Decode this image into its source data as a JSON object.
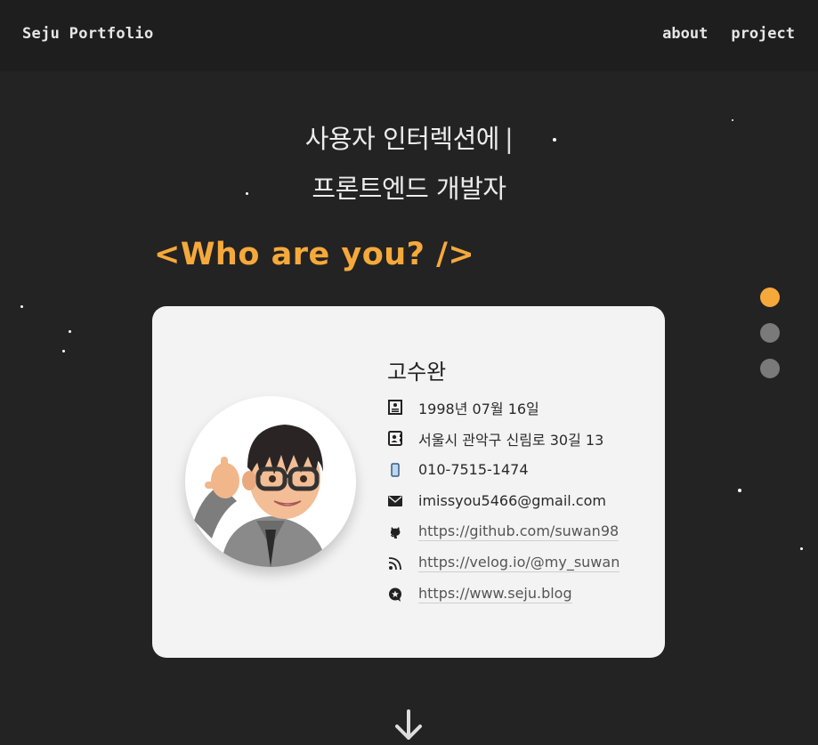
{
  "header": {
    "brand": "Seju Portfolio",
    "nav": [
      {
        "label": "about"
      },
      {
        "label": "project"
      }
    ]
  },
  "hero": {
    "line1": "사용자 인터렉션에",
    "cursor": "|",
    "line2": "프론트엔드 개발자"
  },
  "section": {
    "title": "<Who are you? />"
  },
  "colors": {
    "background": "#232323",
    "accent": "#f6a93b",
    "card": "#f3f3f3",
    "dot_inactive": "#7a7a7a"
  },
  "page_dots": {
    "count": 3,
    "active_index": 0
  },
  "profile": {
    "name": "고수완",
    "rows": [
      {
        "icon": "id-card-icon",
        "text": "1998년 07월 16일",
        "link": false
      },
      {
        "icon": "address-card-icon",
        "text": "서울시 관악구 신림로 30길 13",
        "link": false
      },
      {
        "icon": "mobile-phone-icon",
        "text": "010-7515-1474",
        "link": false
      },
      {
        "icon": "envelope-icon",
        "text": "imissyou5466@gmail.com",
        "link": false
      },
      {
        "icon": "github-icon",
        "text": "https://github.com/suwan98",
        "link": true
      },
      {
        "icon": "rss-icon",
        "text": "https://velog.io/@my_suwan",
        "link": true
      },
      {
        "icon": "star-badge-icon",
        "text": "https://www.seju.blog",
        "link": true
      }
    ]
  }
}
